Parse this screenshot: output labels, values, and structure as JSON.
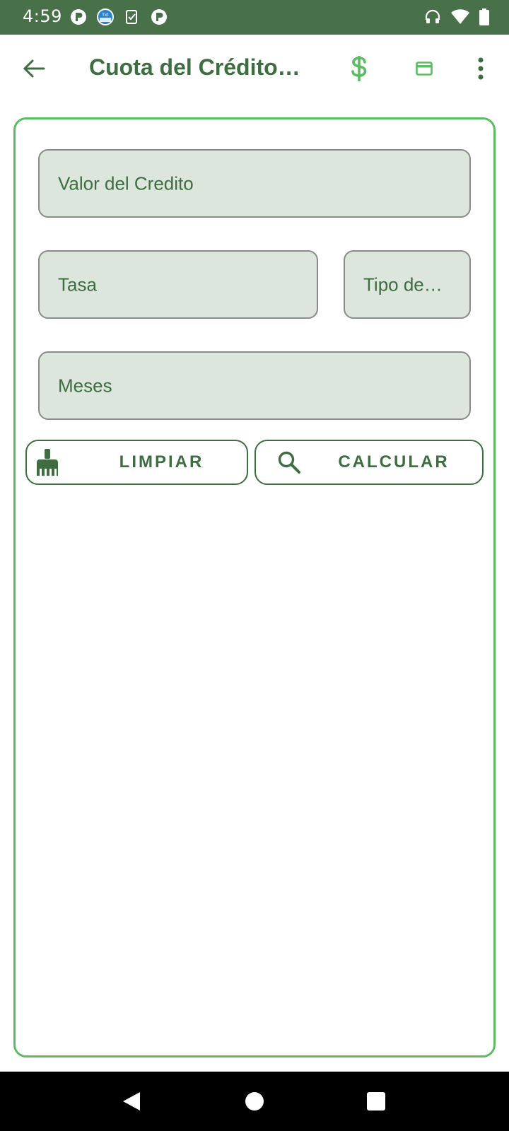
{
  "status_bar": {
    "time": "4:59",
    "left_icons": [
      "p-circle-icon",
      "globe-badge-icon",
      "clipboard-check-icon",
      "p-circle-icon"
    ],
    "right_icons": [
      "headphones-icon",
      "wifi-icon",
      "battery-icon"
    ]
  },
  "app_bar": {
    "title": "Cuota del Crédito…",
    "actions": [
      "dollar-icon",
      "credit-card-icon",
      "more-vert-icon"
    ]
  },
  "form": {
    "valor_placeholder": "Valor del Credito",
    "tasa_placeholder": "Tasa",
    "tipo_placeholder": "Tipo de…",
    "meses_placeholder": "Meses"
  },
  "buttons": {
    "limpiar_label": "LIMPIAR",
    "calcular_label": "CALCULAR"
  },
  "colors": {
    "status_bar": "#487049",
    "primary_text": "#3d6d40",
    "accent": "#5dbb63",
    "field_bg": "#dde6dc"
  }
}
